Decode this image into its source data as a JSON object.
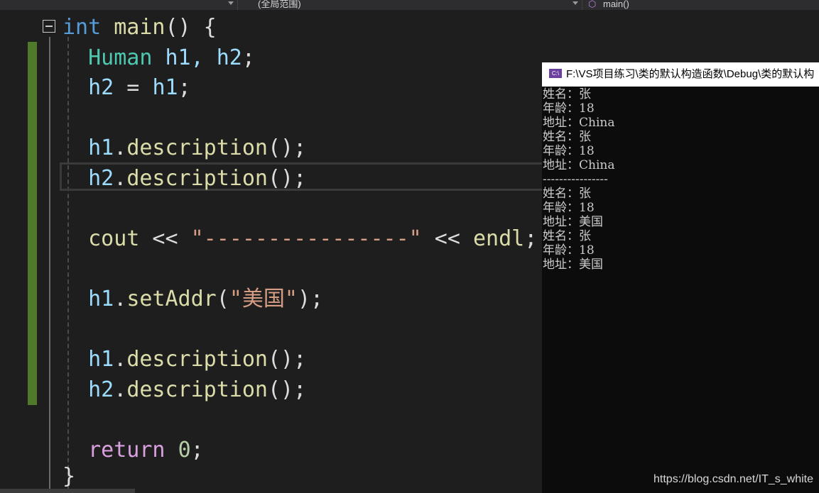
{
  "navbar": {
    "scope_label": "(全局范围)",
    "function_label": "main()"
  },
  "code": {
    "line1": {
      "kw": "int",
      "fn": "main",
      "rest": "() {"
    },
    "line2": {
      "type": "Human",
      "vars": " h1, h2",
      "punct": ";"
    },
    "line3": {
      "v1": "h2",
      "op": " = ",
      "v2": "h1",
      "punct": ";"
    },
    "line4": {
      "obj": "h1",
      "dot": ".",
      "fn": "description",
      "rest": "();"
    },
    "line5": {
      "obj": "h2",
      "dot": ".",
      "fn": "description",
      "rest": "();"
    },
    "line6": {
      "fn1": "cout",
      "op1": " << ",
      "str": "\"----------------\"",
      "op2": " << ",
      "fn2": "endl",
      "punct": ";"
    },
    "line7": {
      "obj": "h1",
      "dot": ".",
      "fn": "setAddr",
      "open": "(",
      "str": "\"美国\"",
      "close": ");"
    },
    "line8": {
      "obj": "h1",
      "dot": ".",
      "fn": "description",
      "rest": "();"
    },
    "line9": {
      "obj": "h2",
      "dot": ".",
      "fn": "description",
      "rest": "();"
    },
    "line10": {
      "kw": "return",
      "num": "0",
      "punct": ";"
    },
    "line11": {
      "brace": "}"
    }
  },
  "console": {
    "title": "F:\\VS项目练习\\类的默认构造函数\\Debug\\类的默认构",
    "icon_text": "C:\\",
    "lines": [
      "姓名：张",
      "年龄：18",
      "地址：China",
      "姓名：张",
      "年龄：18",
      "地址：China",
      "----------------",
      "姓名：张",
      "年龄：18",
      "地址：美国",
      "姓名：张",
      "年龄：18",
      "地址：美国"
    ]
  },
  "watermark": "https://blog.csdn.net/IT_s_white",
  "colors": {
    "editor_bg": "#1e1e1e",
    "keyword": "#569cd6",
    "type": "#4ec9b0",
    "function": "#dcdcaa",
    "variable": "#9cdcfe",
    "string": "#d69d85",
    "number": "#b5cea8",
    "control": "#d8a0df",
    "change_marker": "#4e7a2a",
    "console_bg": "#0c0c0c"
  }
}
